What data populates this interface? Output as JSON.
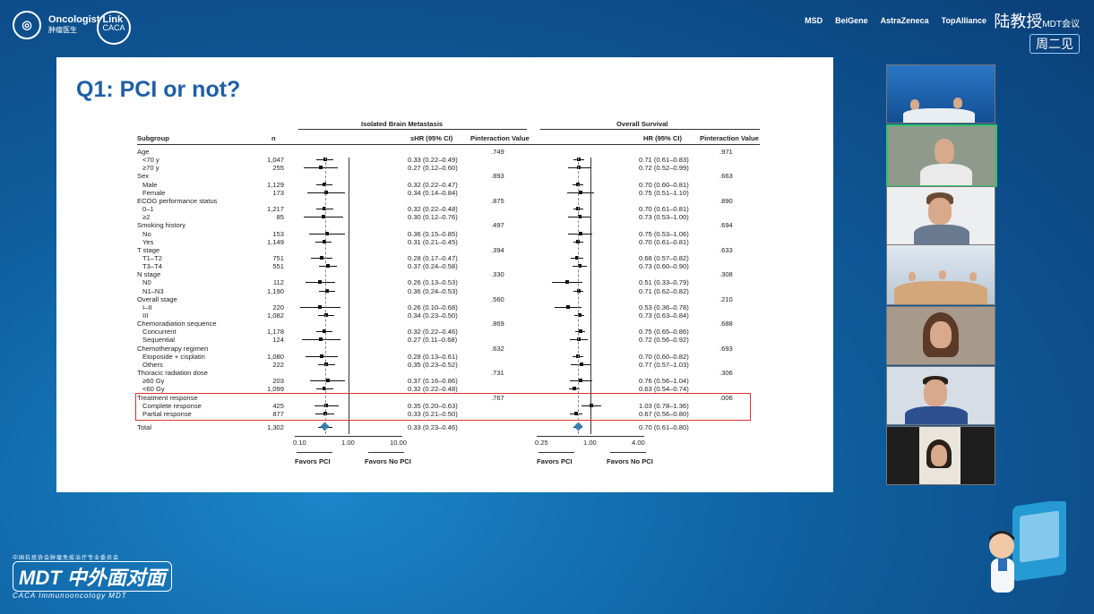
{
  "header": {
    "brand": "Oncologist Link",
    "brand_sub": "肿瘤医生",
    "emblem": "CACA",
    "sponsors": [
      "MSD",
      "BeiGene",
      "AstraZeneca",
      "TopAlliance"
    ],
    "series_title": "陆教授",
    "series_tag": "MDT会议",
    "series_day": "周二见"
  },
  "slide": {
    "title": "Q1: PCI or not?",
    "forest": {
      "section_left": "Isolated Brain Metastasis",
      "section_right": "Overall Survival",
      "col_subgroup": "Subgroup",
      "col_n": "n",
      "col_shr": "sHR (95% CI)",
      "col_p": "Pinteraction Value",
      "col_hr": "HR (95% CI)",
      "rows": [
        {
          "label": "Age",
          "type": "group",
          "p1": ".749",
          "p2": ".971"
        },
        {
          "label": "<70 y",
          "type": "sub",
          "n": "1,047",
          "shr": "0.33 (0.22–0.49)",
          "hr": "0.71 (0.61–0.83)"
        },
        {
          "label": "≥70 y",
          "type": "sub",
          "n": "255",
          "shr": "0.27 (0.12–0.60)",
          "hr": "0.72 (0.52–0.99)"
        },
        {
          "label": "Sex",
          "type": "group",
          "p1": ".893",
          "p2": ".663"
        },
        {
          "label": "Male",
          "type": "sub",
          "n": "1,129",
          "shr": "0.32 (0.22–0.47)",
          "hr": "0.70 (0.60–0.81)"
        },
        {
          "label": "Female",
          "type": "sub",
          "n": "173",
          "shr": "0.34 (0.14–0.84)",
          "hr": "0.75 (0.51–1.10)"
        },
        {
          "label": "ECOG performance status",
          "type": "group",
          "p1": ".875",
          "p2": ".890"
        },
        {
          "label": "0–1",
          "type": "sub",
          "n": "1,217",
          "shr": "0.32 (0.22–0.48)",
          "hr": "0.70 (0.61–0.81)"
        },
        {
          "label": "≥2",
          "type": "sub",
          "n": "85",
          "shr": "0.30 (0.12–0.76)",
          "hr": "0.73 (0.53–1.00)"
        },
        {
          "label": "Smoking history",
          "type": "group",
          "p1": ".497",
          "p2": ".694"
        },
        {
          "label": "No",
          "type": "sub",
          "n": "153",
          "shr": "0.36 (0.15–0.85)",
          "hr": "0.75 (0.53–1.06)"
        },
        {
          "label": "Yes",
          "type": "sub",
          "n": "1,149",
          "shr": "0.31 (0.21–0.45)",
          "hr": "0.70 (0.61–0.81)"
        },
        {
          "label": "T stage",
          "type": "group",
          "p1": ".394",
          "p2": ".633"
        },
        {
          "label": "T1–T2",
          "type": "sub",
          "n": "751",
          "shr": "0.28 (0.17–0.47)",
          "hr": "0.68 (0.57–0.82)"
        },
        {
          "label": "T3–T4",
          "type": "sub",
          "n": "551",
          "shr": "0.37 (0.24–0.58)",
          "hr": "0.73 (0.60–0.90)"
        },
        {
          "label": "N stage",
          "type": "group",
          "p1": ".330",
          "p2": ".308"
        },
        {
          "label": "N0",
          "type": "sub",
          "n": "112",
          "shr": "0.26 (0.13–0.53)",
          "hr": "0.51 (0.33–0.79)"
        },
        {
          "label": "N1–N3",
          "type": "sub",
          "n": "1,190",
          "shr": "0.36 (0.24–0.53)",
          "hr": "0.71 (0.62–0.82)"
        },
        {
          "label": "Overall stage",
          "type": "group",
          "p1": ".560",
          "p2": ".210"
        },
        {
          "label": "I–II",
          "type": "sub",
          "n": "220",
          "shr": "0.26 (0.10–0.68)",
          "hr": "0.53 (0.36–0.78)"
        },
        {
          "label": "III",
          "type": "sub",
          "n": "1,082",
          "shr": "0.34 (0.23–0.50)",
          "hr": "0.73 (0.63–0.84)"
        },
        {
          "label": "Chemoradiation sequence",
          "type": "group",
          "p1": ".869",
          "p2": ".688"
        },
        {
          "label": "Concurrent",
          "type": "sub",
          "n": "1,178",
          "shr": "0.32 (0.22–0.46)",
          "hr": "0.75 (0.65–0.86)"
        },
        {
          "label": "Sequential",
          "type": "sub",
          "n": "124",
          "shr": "0.27 (0.11–0.68)",
          "hr": "0.72 (0.56–0.92)"
        },
        {
          "label": "Chemotherapy regimen",
          "type": "group",
          "p1": ".632",
          "p2": ".693"
        },
        {
          "label": "Etoposide + cisplatin",
          "type": "sub",
          "n": "1,080",
          "shr": "0.28 (0.13–0.61)",
          "hr": "0.70 (0.60–0.82)"
        },
        {
          "label": "Others",
          "type": "sub",
          "n": "222",
          "shr": "0.35 (0.23–0.52)",
          "hr": "0.77 (0.57–1.03)"
        },
        {
          "label": "Thoracic radiation dose",
          "type": "group",
          "p1": ".731",
          "p2": ".306"
        },
        {
          "label": "≥60 Gy",
          "type": "sub",
          "n": "203",
          "shr": "0.37 (0.16–0.86)",
          "hr": "0.76 (0.56–1.04)"
        },
        {
          "label": "<60 Gy",
          "type": "sub",
          "n": "1,099",
          "shr": "0.32 (0.22–0.48)",
          "hr": "0.63 (0.54–0.74)"
        },
        {
          "label": "Treatment response",
          "type": "group",
          "p1": ".767",
          "p2": ".006"
        },
        {
          "label": "Complete response",
          "type": "sub",
          "n": "425",
          "shr": "0.35 (0.20–0.63)",
          "hr": "1.03 (0.78–1.36)"
        },
        {
          "label": "Partial response",
          "type": "sub",
          "n": "877",
          "shr": "0.33 (0.21–0.50)",
          "hr": "0.67 (0.56–0.80)"
        },
        {
          "label": "Total",
          "type": "total",
          "n": "1,302",
          "shr": "0.33 (0.23–0.46)",
          "hr": "0.70 (0.61–0.80)"
        }
      ],
      "left_ticks": [
        "0.10",
        "1.00",
        "10.00"
      ],
      "right_ticks": [
        "0.25",
        "1.00",
        "4.00"
      ],
      "favors_a": "Favors PCI",
      "favors_b": "Favors No PCI"
    }
  },
  "chart_data": {
    "type": "forest",
    "title": "Q1: PCI or not?",
    "panels": [
      {
        "name": "Isolated Brain Metastasis",
        "measure": "sHR (95% CI)",
        "scale": "log",
        "ticks": [
          0.1,
          1.0,
          10.0
        ]
      },
      {
        "name": "Overall Survival",
        "measure": "HR (95% CI)",
        "scale": "log",
        "ticks": [
          0.25,
          1.0,
          4.0
        ]
      }
    ],
    "highlight": "Treatment response"
  },
  "participants": [
    {
      "name": "panel-1"
    },
    {
      "name": "panel-2"
    },
    {
      "name": "panel-3"
    },
    {
      "name": "panel-4"
    },
    {
      "name": "panel-5"
    },
    {
      "name": "panel-6"
    },
    {
      "name": "panel-7"
    }
  ],
  "footer": {
    "org_line": "中国抗癌协会肿瘤免疫治疗专业委员会",
    "logo": "MDT 中外面对面",
    "caption": "CACA Immunooncology MDT"
  }
}
